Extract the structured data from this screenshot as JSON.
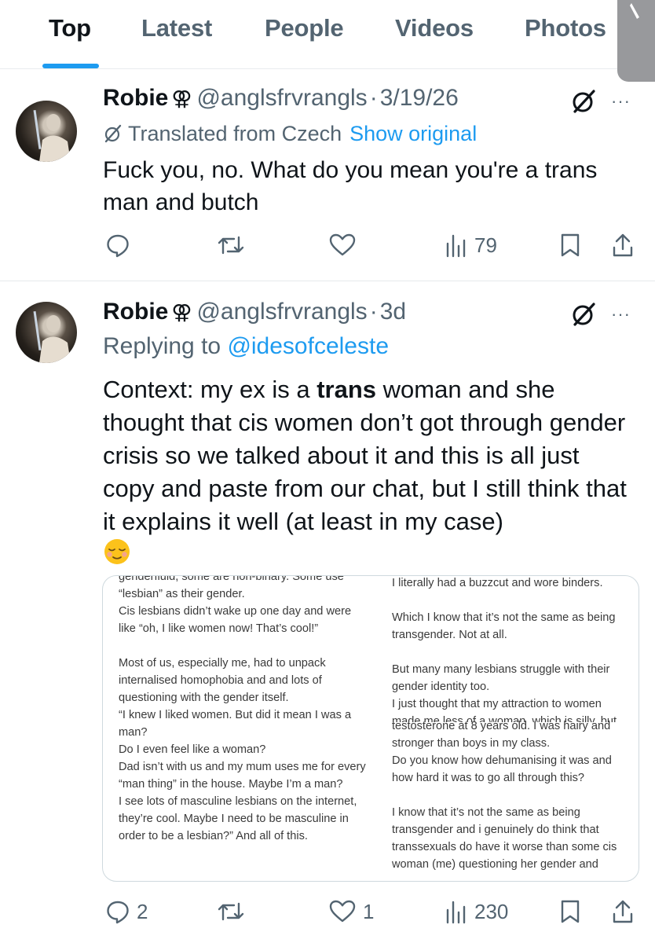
{
  "tabs": [
    {
      "label": "Top",
      "active": true
    },
    {
      "label": "Latest",
      "active": false
    },
    {
      "label": "People",
      "active": false
    },
    {
      "label": "Videos",
      "active": false
    },
    {
      "label": "Photos",
      "active": false
    }
  ],
  "colors": {
    "accent": "#1d9bf0",
    "text": "#0f1419",
    "muted": "#536471"
  },
  "tweets": [
    {
      "name": "Robie",
      "name_symbol": "⚢",
      "handle": "@anglsfrvrangls",
      "separator": "·",
      "time": "3/19/26",
      "more": "···",
      "translated_label": "Translated from Czech",
      "show_original": "Show original",
      "text": "Fuck you, no. What do you mean you're a trans man and butch",
      "stats": {
        "replies": "",
        "reposts": "",
        "likes": "",
        "views": "79"
      }
    },
    {
      "name": "Robie",
      "name_symbol": "⚢",
      "handle": "@anglsfrvrangls",
      "separator": "·",
      "time": "3d",
      "more": "···",
      "replying_label": "Replying to",
      "replying_to": "@idesofceleste",
      "text_before": "Context: my ex is a ",
      "text_bold": "trans",
      "text_after": " woman and she thought that cis women don’t got through gender crisis so we talked about it and this is all just copy and paste from our chat, but I still think that it explains it well (at least in my case)",
      "emoji": "relieved-face",
      "media": {
        "left_column": [
          "genderfluid, some are non-binary. Some use",
          "“lesbian” as their gender.",
          "Cis lesbians didn’t wake up one day and were like “oh, I like women now! That’s cool!”",
          "",
          "Most of us, especially me, had to unpack internalised homophobia and and lots of questioning with the gender itself.",
          "“I knew I liked women. But did it mean I was a man?",
          "Do I even feel like a woman?",
          "Dad isn’t with us and my mum uses me for every “man thing” in the house. Maybe I’m a man?",
          "I see lots of masculine lesbians on the internet, they’re cool. Maybe I need to be masculine in order to be a lesbian?” And all of this."
        ],
        "right_column_top": [
          "I literally had a buzzcut and wore binders.",
          "",
          "Which I know that it’s not the same as being transgender. Not at all.",
          "",
          "But many many lesbians struggle with their gender identity too.",
          "I just thought that my attraction to women made me less of a woman, which is silly, but"
        ],
        "right_column_bottom": [
          "testosterone at 8 years old. I was hairy and stronger than boys in my class.",
          "Do you know how dehumanising it was and how hard it was to go all through this?",
          "",
          "I know that it’s not the same as being transgender and i genuinely do think that transsexuals do have it worse than some cis woman (me) questioning her gender and"
        ]
      },
      "stats": {
        "replies": "2",
        "reposts": "",
        "likes": "1",
        "views": "230"
      }
    }
  ]
}
